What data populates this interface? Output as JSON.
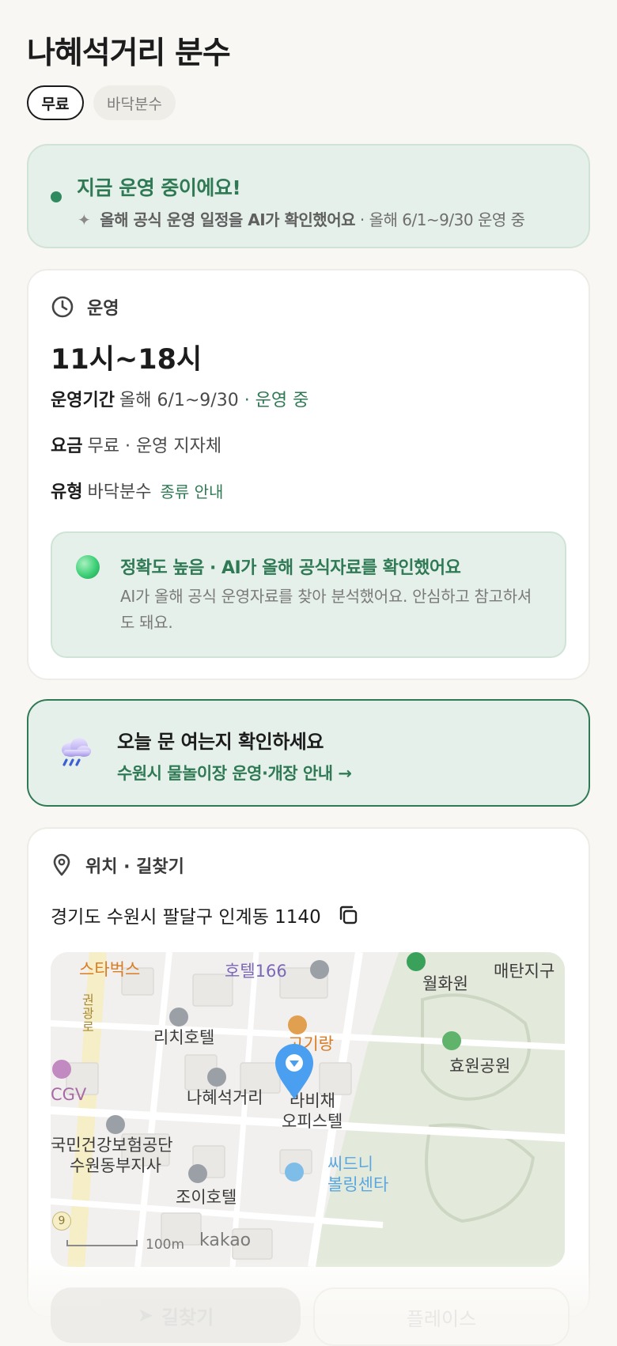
{
  "header": {
    "title": "나혜석거리 분수",
    "chips": [
      "무료",
      "바닥분수"
    ]
  },
  "status": {
    "title": "지금 운영 중이에요!",
    "sub_strong": "올해 공식 운영 일정을 AI가 확인했어요",
    "sub_rest": "· 올해 6/1~9/30 운영 중"
  },
  "operation": {
    "section_label": "운영",
    "hours": "11시~18시",
    "period_label": "운영기간",
    "period_value": "올해 6/1~9/30",
    "period_status": "· 운영 중",
    "fee_label": "요금",
    "fee_value": "무료 · 운영 지자체",
    "type_label": "유형",
    "type_value": "바닥분수",
    "type_link": "종류 안내",
    "accuracy_title": "정확도 높음 · AI가 올해 공식자료를 확인했어요",
    "accuracy_desc": "AI가 올해 공식 운영자료를 찾아 분석했어요. 안심하고 참고하셔도 돼요."
  },
  "cta": {
    "title": "오늘 문 여는지 확인하세요",
    "link": "수원시 물놀이장 운영·개장 안내 →"
  },
  "location": {
    "section_label": "위치 · 길찾기",
    "address": "경기도 수원시 팔달구 인계동 1140",
    "map_labels": {
      "starbucks": "스타벅스",
      "hotel166": "호텔166",
      "wolhwawon": "월화원",
      "maetan": "매탄지구",
      "richi": "리치호텔",
      "hyowon": "효원공원",
      "gogirang": "고기랑",
      "cgv": "CGV",
      "naheseok": "나혜석거리",
      "rabichae": "라비채",
      "officetel": "오피스텔",
      "nhis1": "국민건강보험공단",
      "nhis2": "수원동부지사",
      "disney1": "씨드니",
      "disney2": "볼링센타",
      "joy": "조이호텔",
      "road": "권광로",
      "scale": "100m",
      "kakao": "kakao",
      "badge": "9"
    }
  },
  "bottom": {
    "directions": "길찾기",
    "place": "플레이스"
  },
  "colors": {
    "accent_green": "#2f7a55",
    "mint_bg": "#e6f0ea",
    "pin_blue": "#4a9ff0"
  }
}
